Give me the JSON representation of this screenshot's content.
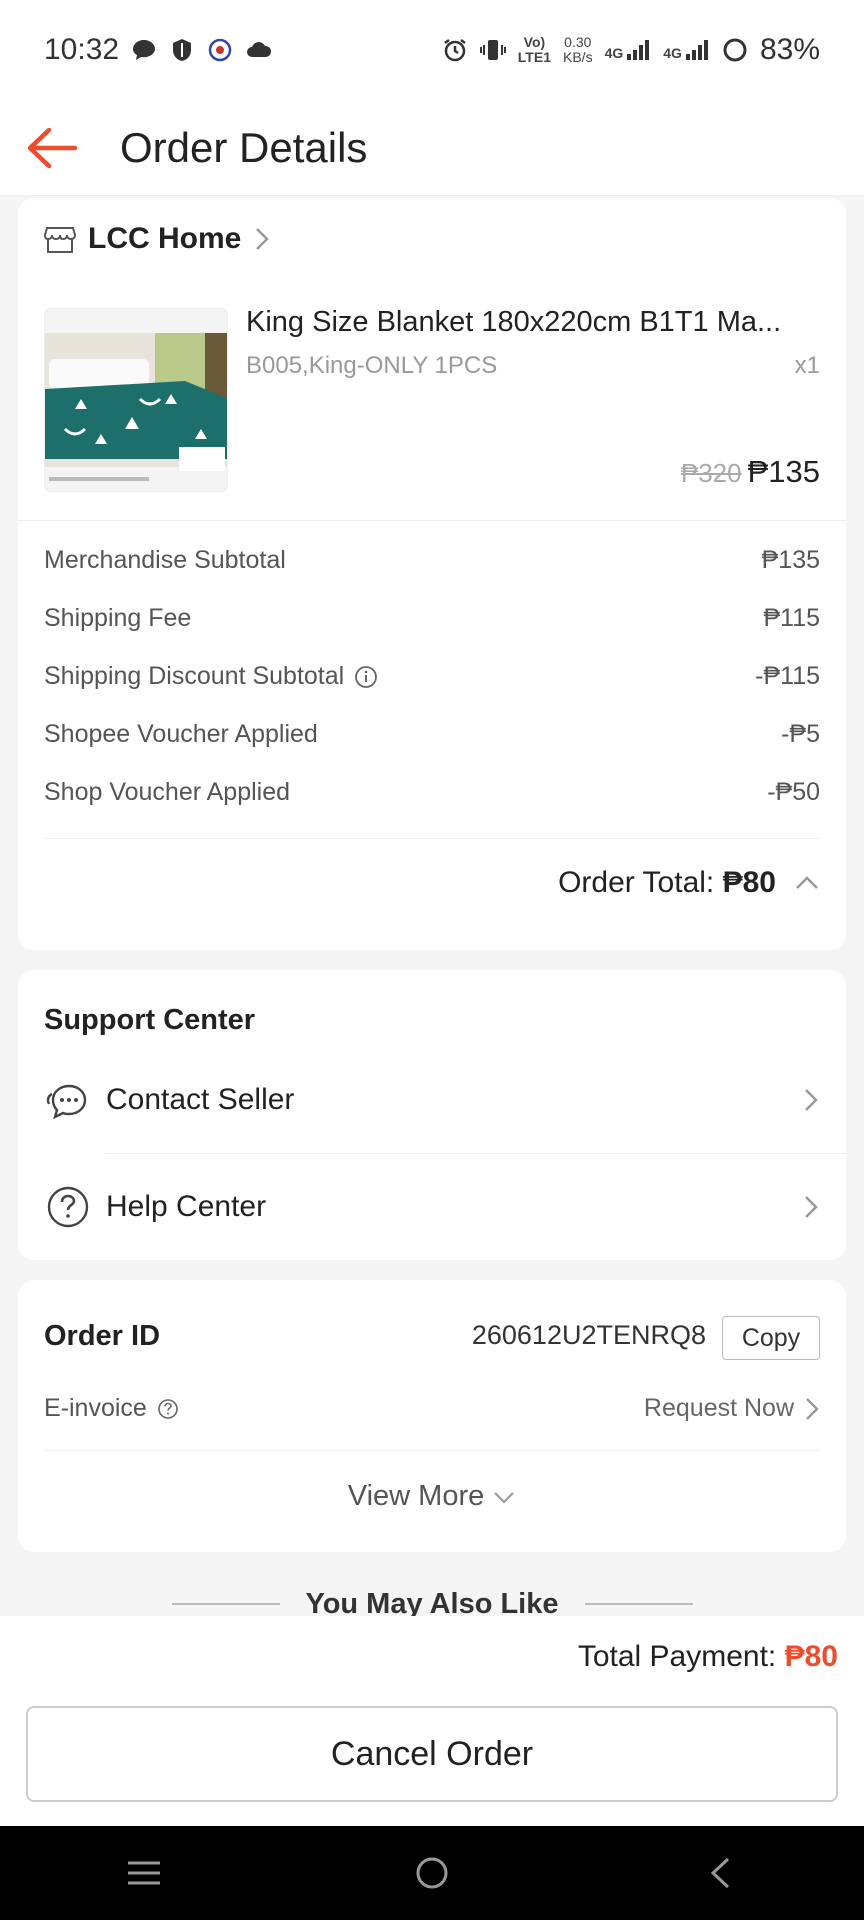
{
  "status_bar": {
    "time": "10:32",
    "net_top": "Vo)",
    "net_bottom": "LTE1",
    "speed_top": "0.30",
    "speed_bottom": "KB/s",
    "sig1": "4G",
    "sig2": "4G",
    "battery": "83%"
  },
  "header": {
    "title": "Order Details"
  },
  "order": {
    "shop_name": "LCC Home",
    "product": {
      "name": "King Size Blanket 180x220cm B1T1 Ma...",
      "variation": "B005,King-ONLY 1PCS",
      "quantity": "x1",
      "original_price": "₱320",
      "price": "₱135"
    },
    "summary": [
      {
        "label": "Merchandise Subtotal",
        "value": "₱135"
      },
      {
        "label": "Shipping Fee",
        "value": "₱115"
      },
      {
        "label": "Shipping Discount Subtotal",
        "value": "-₱115"
      },
      {
        "label": "Shopee Voucher Applied",
        "value": "-₱5"
      },
      {
        "label": "Shop Voucher Applied",
        "value": "-₱50"
      }
    ],
    "order_total_label": "Order Total:",
    "order_total_value": "₱80"
  },
  "support": {
    "title": "Support Center",
    "items": [
      {
        "label": "Contact Seller"
      },
      {
        "label": "Help Center"
      }
    ]
  },
  "order_info": {
    "id_label": "Order ID",
    "id_value": "260612U2TENRQ8",
    "copy_label": "Copy",
    "einvoice_label": "E-invoice",
    "request_label": "Request Now",
    "view_more": "View More"
  },
  "recommend_title": "You May Also Like",
  "footer": {
    "total_label": "Total Payment:",
    "total_value": "₱80",
    "cancel_label": "Cancel Order"
  },
  "colors": {
    "accent": "#ee4d2d"
  }
}
